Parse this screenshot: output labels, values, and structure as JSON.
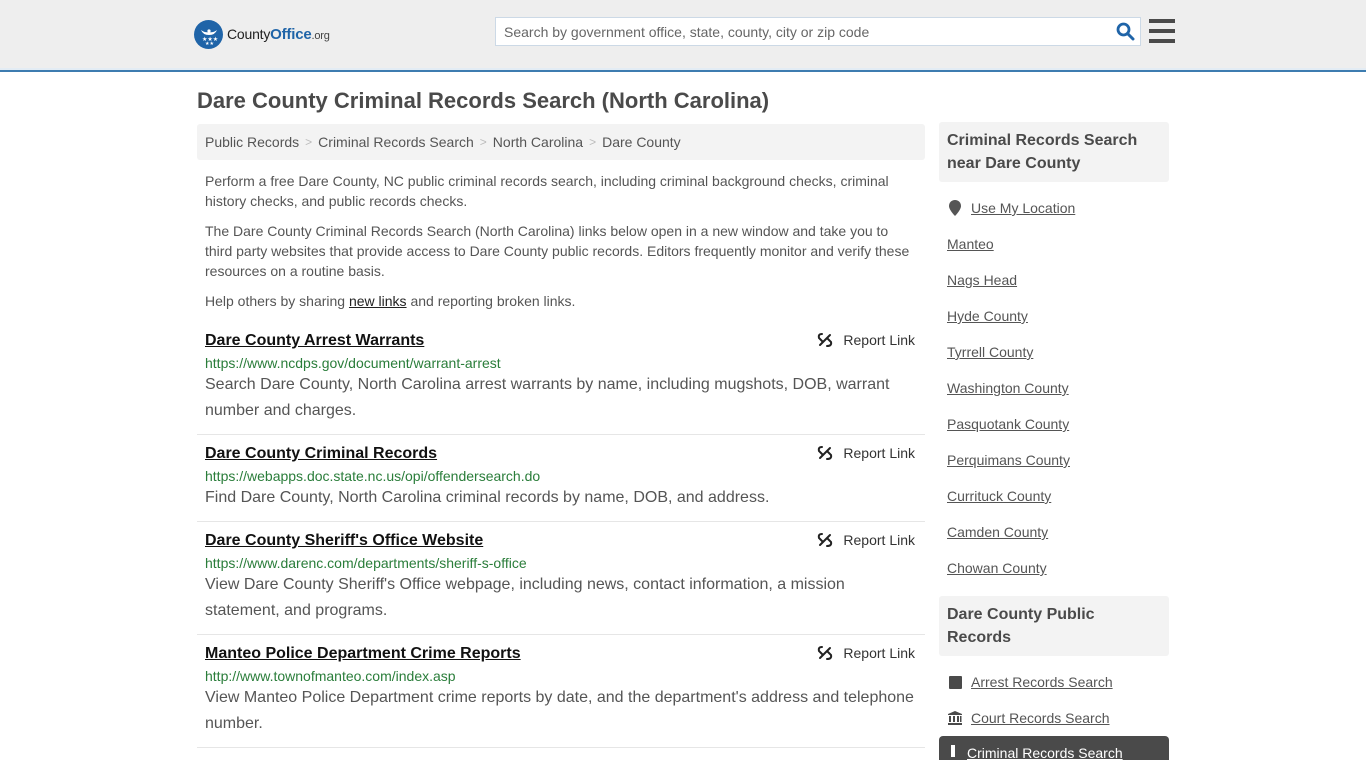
{
  "header": {
    "logo": {
      "prefix": "County",
      "brand": "Office",
      "tld": ".org"
    },
    "search_placeholder": "Search by government office, state, county, city or zip code",
    "search_value": ""
  },
  "page": {
    "title": "Dare County Criminal Records Search (North Carolina)"
  },
  "breadcrumb": [
    {
      "label": "Public Records"
    },
    {
      "label": "Criminal Records Search"
    },
    {
      "label": "North Carolina"
    },
    {
      "label": "Dare County"
    }
  ],
  "intro": {
    "p1": "Perform a free Dare County, NC public criminal records search, including criminal background checks, criminal history checks, and public records checks.",
    "p2": "The Dare County Criminal Records Search (North Carolina) links below open in a new window and take you to third party websites that provide access to Dare County public records. Editors frequently monitor and verify these resources on a routine basis.",
    "p3_before": "Help others by sharing ",
    "p3_link": "new links",
    "p3_after": " and reporting broken links."
  },
  "results": [
    {
      "title": "Dare County Arrest Warrants",
      "url": "https://www.ncdps.gov/document/warrant-arrest",
      "description": "Search Dare County, North Carolina arrest warrants by name, including mugshots, DOB, warrant number and charges.",
      "report_label": "Report Link"
    },
    {
      "title": "Dare County Criminal Records",
      "url": "https://webapps.doc.state.nc.us/opi/offendersearch.do",
      "description": "Find Dare County, North Carolina criminal records by name, DOB, and address.",
      "report_label": "Report Link"
    },
    {
      "title": "Dare County Sheriff's Office Website",
      "url": "https://www.darenc.com/departments/sheriff-s-office",
      "description": "View Dare County Sheriff's Office webpage, including news, contact information, a mission statement, and programs.",
      "report_label": "Report Link"
    },
    {
      "title": "Manteo Police Department Crime Reports",
      "url": "http://www.townofmanteo.com/index.asp",
      "description": "View Manteo Police Department crime reports by date, and the department's address and telephone number.",
      "report_label": "Report Link"
    }
  ],
  "sidebar": {
    "nearby": {
      "heading": "Criminal Records Search near Dare County",
      "use_location": "Use My Location",
      "items": [
        "Manteo",
        "Nags Head",
        "Hyde County",
        "Tyrrell County",
        "Washington County",
        "Pasquotank County",
        "Perquimans County",
        "Currituck County",
        "Camden County",
        "Chowan County"
      ]
    },
    "public_records": {
      "heading": "Dare County Public Records",
      "items": [
        {
          "label": "Arrest Records Search",
          "icon": "square-icon"
        },
        {
          "label": "Court Records Search",
          "icon": "courthouse-icon"
        },
        {
          "label": "Criminal Records Search",
          "icon": "exclamation-icon",
          "active": true
        }
      ]
    }
  },
  "colors": {
    "brand_blue": "#1f64a8",
    "header_border": "#3d7cb0",
    "url_green": "#2a7d3a",
    "active_item_bg": "#4a4a4a"
  }
}
